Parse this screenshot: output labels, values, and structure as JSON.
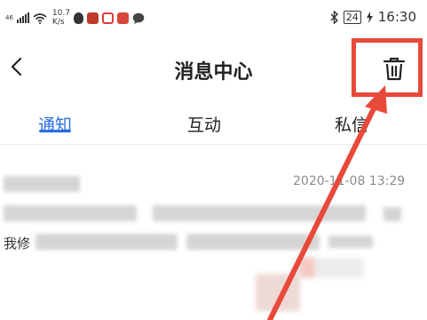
{
  "status_bar": {
    "signal_label": "46",
    "net_speed_value": "10.7",
    "net_speed_unit": "K/s",
    "battery": "24",
    "time": "16:30"
  },
  "nav": {
    "back_icon": "chevron-left-icon",
    "title": "消息中心",
    "delete_icon": "trash-icon"
  },
  "tabs": [
    {
      "label": "通知",
      "active": true
    },
    {
      "label": "互动",
      "active": false
    },
    {
      "label": "私信",
      "active": false
    }
  ],
  "message": {
    "timestamp": "2020-11-08 13:29",
    "body_prefix": "我修"
  },
  "colors": {
    "accent": "#2a6fe0",
    "highlight": "#e8493a"
  }
}
